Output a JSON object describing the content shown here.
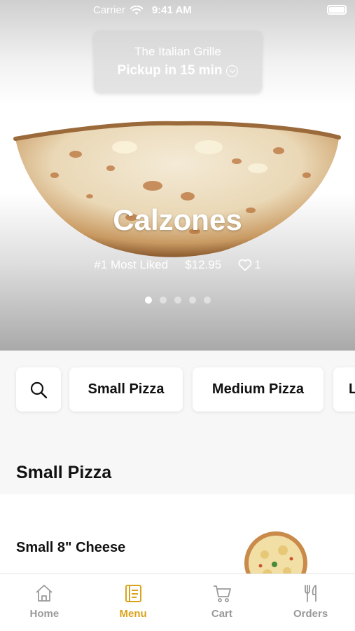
{
  "status_bar": {
    "carrier": "Carrier",
    "time": "9:41 AM"
  },
  "pickup": {
    "restaurant": "The Italian Grille",
    "time_label": "Pickup in 15 min"
  },
  "featured": {
    "title": "Calzones",
    "badge": "#1 Most Liked",
    "price": "$12.95",
    "likes": "1",
    "dots_total": 5,
    "active_dot": 0
  },
  "categories": {
    "search_icon": "search-icon",
    "chips": [
      "Small Pizza",
      "Medium Pizza",
      "L"
    ]
  },
  "section": {
    "heading": "Small Pizza",
    "items": [
      {
        "name": "Small 8\" Cheese"
      }
    ]
  },
  "tab_bar": {
    "tabs": [
      {
        "label": "Home",
        "icon": "home-icon"
      },
      {
        "label": "Menu",
        "icon": "menu-icon"
      },
      {
        "label": "Cart",
        "icon": "cart-icon"
      },
      {
        "label": "Orders",
        "icon": "fork-knife-icon"
      }
    ],
    "active_index": 1,
    "active_color": "#d9a21b",
    "inactive_color": "#9a9a9a"
  }
}
